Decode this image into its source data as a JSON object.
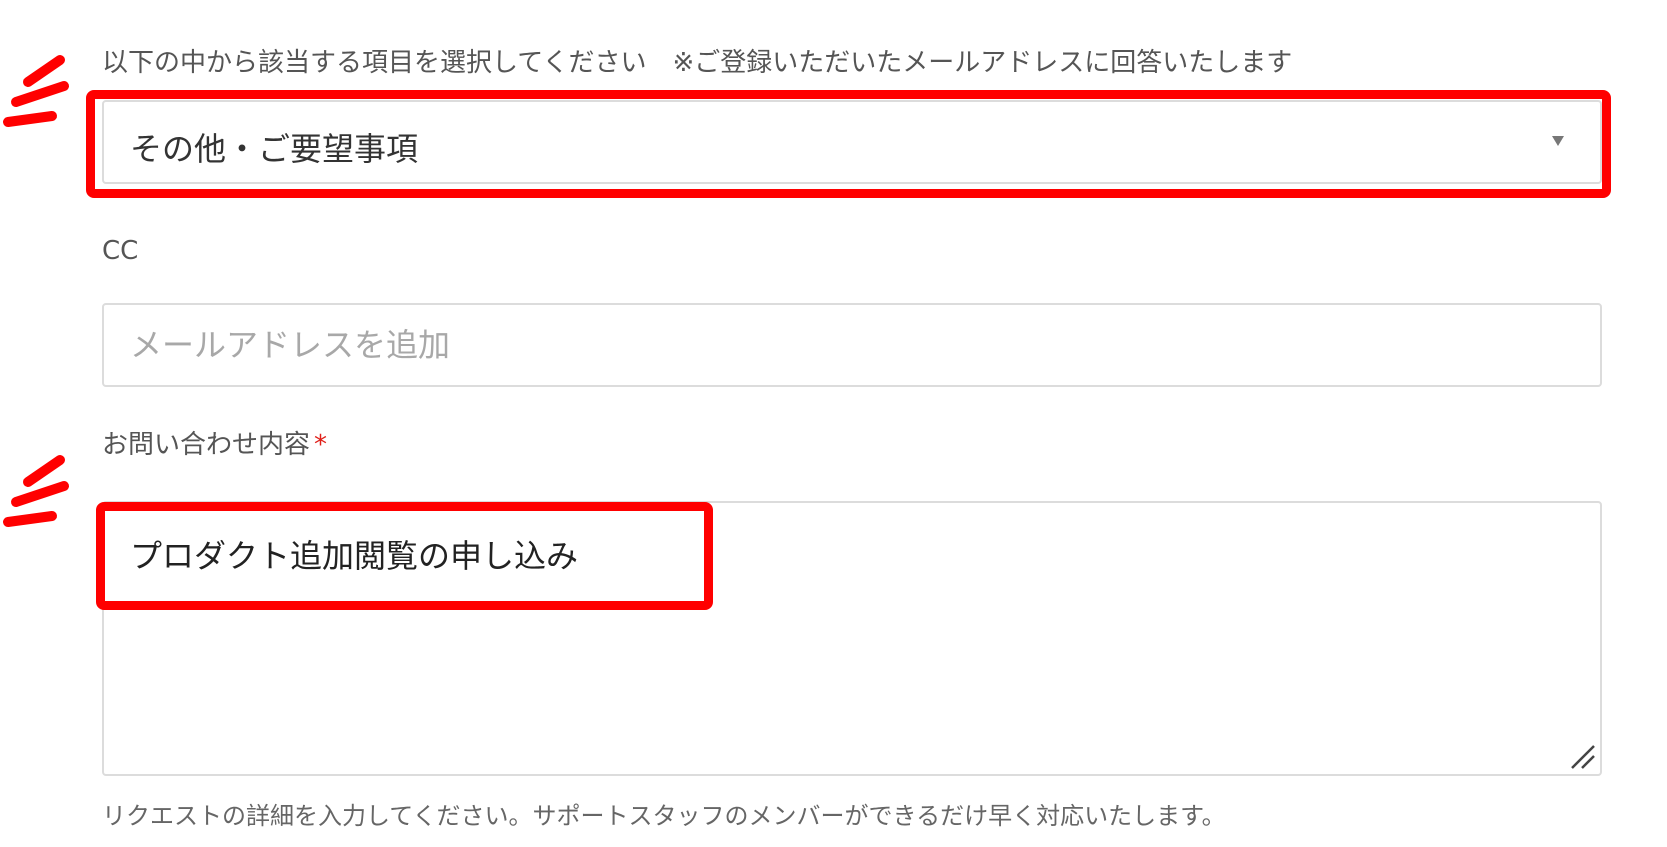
{
  "form": {
    "category": {
      "label": "以下の中から該当する項目を選択してください　※ご登録いただいたメールアドレスに回答いたします",
      "selected": "その他・ご要望事項"
    },
    "cc": {
      "label": "CC",
      "placeholder": "メールアドレスを追加",
      "value": ""
    },
    "inquiry": {
      "label": "お問い合わせ内容",
      "required_mark": "*",
      "value": "プロダクト追加閲覧の申し込み",
      "hint": "リクエストの詳細を入力してください。サポートスタッフのメンバーができるだけ早く対応いたします。"
    }
  },
  "icons": {
    "dropdown": "caret-down-icon",
    "resize": "resize-handle-icon",
    "emphasis": "emphasis-burst-icon"
  },
  "colors": {
    "highlight": "#ff0000",
    "required": "#e0201a",
    "border": "#dcdcdc",
    "placeholder": "#a8a8a8"
  }
}
